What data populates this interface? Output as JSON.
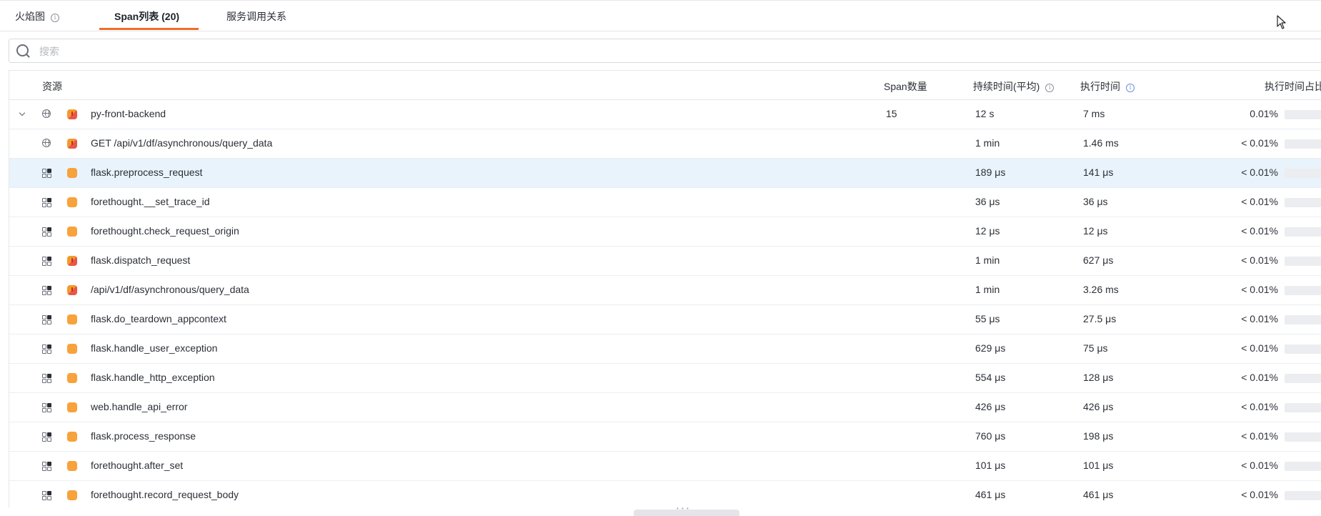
{
  "tabs": {
    "flame": "火焰图",
    "span_list": "Span列表 (20)",
    "service_calls": "服务调用关系",
    "info_glyph": "i"
  },
  "search": {
    "placeholder": "搜索"
  },
  "table": {
    "headers": {
      "resource": "资源",
      "span_count": "Span数量",
      "duration": "持续时间(平均)",
      "exec_time": "执行时间",
      "exec_pct": "执行时间占比"
    },
    "rows": [
      {
        "type": "service",
        "expanded": true,
        "status": "error",
        "name": "py-front-backend",
        "count": "15",
        "duration": "12 s",
        "exec": "7 ms",
        "pct": "0.01%",
        "pct_value": 0.0001
      },
      {
        "type": "web",
        "status": "error",
        "name": "GET /api/v1/df/asynchronous/query_data",
        "count": "",
        "duration": "1 min",
        "exec": "1.46 ms",
        "pct": "< 0.01%",
        "pct_value": 0
      },
      {
        "type": "custom",
        "status": "ok",
        "name": "flask.preprocess_request",
        "count": "",
        "duration": "189 μs",
        "exec": "141 μs",
        "pct": "< 0.01%",
        "pct_value": 0,
        "selected": true
      },
      {
        "type": "custom",
        "status": "ok",
        "name": "forethought.__set_trace_id",
        "count": "",
        "duration": "36 μs",
        "exec": "36 μs",
        "pct": "< 0.01%",
        "pct_value": 0
      },
      {
        "type": "custom",
        "status": "ok",
        "name": "forethought.check_request_origin",
        "count": "",
        "duration": "12 μs",
        "exec": "12 μs",
        "pct": "< 0.01%",
        "pct_value": 0
      },
      {
        "type": "custom",
        "status": "error",
        "name": "flask.dispatch_request",
        "count": "",
        "duration": "1 min",
        "exec": "627 μs",
        "pct": "< 0.01%",
        "pct_value": 0
      },
      {
        "type": "custom",
        "status": "error",
        "name": "/api/v1/df/asynchronous/query_data",
        "count": "",
        "duration": "1 min",
        "exec": "3.26 ms",
        "pct": "< 0.01%",
        "pct_value": 0
      },
      {
        "type": "custom",
        "status": "ok",
        "name": "flask.do_teardown_appcontext",
        "count": "",
        "duration": "55 μs",
        "exec": "27.5 μs",
        "pct": "< 0.01%",
        "pct_value": 0
      },
      {
        "type": "custom",
        "status": "ok",
        "name": "flask.handle_user_exception",
        "count": "",
        "duration": "629 μs",
        "exec": "75 μs",
        "pct": "< 0.01%",
        "pct_value": 0
      },
      {
        "type": "custom",
        "status": "ok",
        "name": "flask.handle_http_exception",
        "count": "",
        "duration": "554 μs",
        "exec": "128 μs",
        "pct": "< 0.01%",
        "pct_value": 0
      },
      {
        "type": "custom",
        "status": "ok",
        "name": "web.handle_api_error",
        "count": "",
        "duration": "426 μs",
        "exec": "426 μs",
        "pct": "< 0.01%",
        "pct_value": 0
      },
      {
        "type": "custom",
        "status": "ok",
        "name": "flask.process_response",
        "count": "",
        "duration": "760 μs",
        "exec": "198 μs",
        "pct": "< 0.01%",
        "pct_value": 0
      },
      {
        "type": "custom",
        "status": "ok",
        "name": "forethought.after_set",
        "count": "",
        "duration": "101 μs",
        "exec": "101 μs",
        "pct": "< 0.01%",
        "pct_value": 0
      },
      {
        "type": "custom",
        "status": "ok",
        "name": "forethought.record_request_body",
        "count": "",
        "duration": "461 μs",
        "exec": "461 μs",
        "pct": "< 0.01%",
        "pct_value": 0
      }
    ]
  },
  "colors": {
    "accent": "#f26b2a",
    "status_ok": "#f7a23b",
    "status_error": "#e8564a",
    "selected_row": "#e9f3fb"
  }
}
